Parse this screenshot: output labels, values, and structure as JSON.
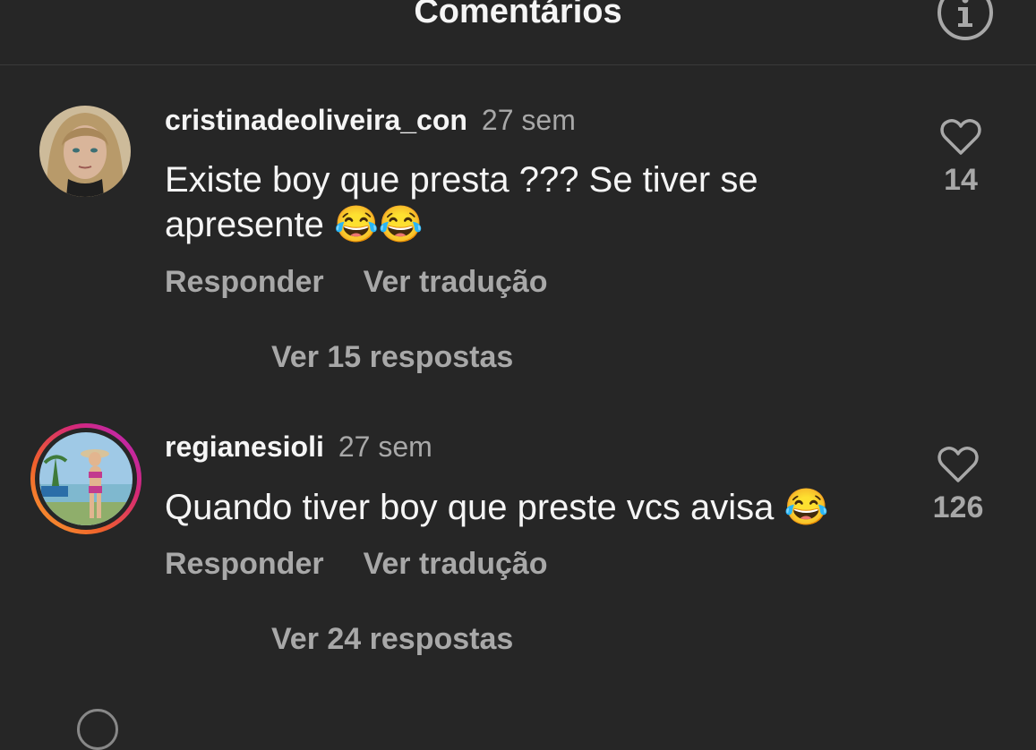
{
  "header": {
    "title": "Comentários",
    "info_icon": "info-icon"
  },
  "comments": [
    {
      "username": "cristinadeoliveira_con",
      "time": "27 sem",
      "text": "Existe boy que presta ??? Se tiver se apresente",
      "emojis": [
        "😂",
        "😂"
      ],
      "reply_label": "Responder",
      "translate_label": "Ver tradução",
      "like_count": "14",
      "view_replies": "Ver 15 respostas"
    },
    {
      "username": "regianesioli",
      "time": "27 sem",
      "text": "Quando tiver boy que preste vcs avisa",
      "emojis": [
        "😂"
      ],
      "reply_label": "Responder",
      "translate_label": "Ver tradução",
      "like_count": "126",
      "view_replies": "Ver 24 respostas",
      "has_story_ring": true
    }
  ],
  "colors": {
    "background": "#262626",
    "primary_text": "#f5f5f5",
    "secondary_text": "#a8a8a8",
    "divider": "#3a3a3a",
    "story_ring": [
      "#f9a431",
      "#d62976",
      "#b326c6"
    ]
  }
}
